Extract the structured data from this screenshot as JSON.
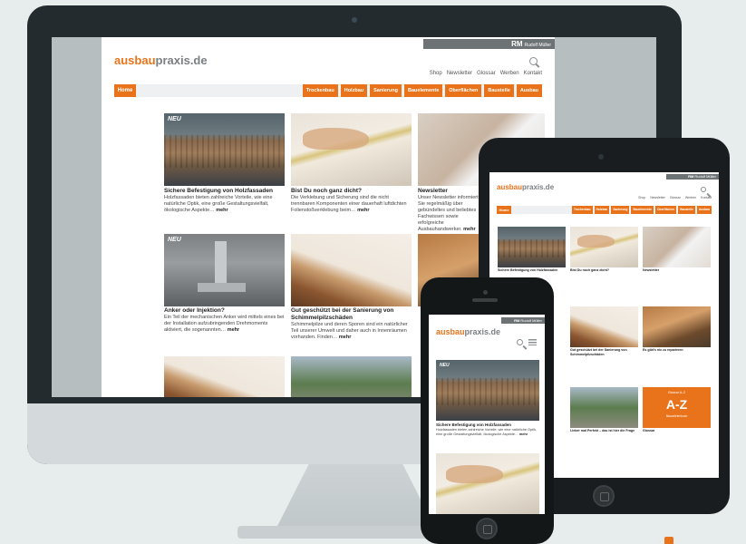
{
  "site": {
    "logo_part1": "ausbau",
    "logo_part2": "praxis.de",
    "brand_badge": "RM",
    "brand_name": "Rudolf Müller",
    "top_links": [
      "Shop",
      "Newsletter",
      "Glossar",
      "Werben",
      "Kontakt"
    ],
    "nav_home": "Home",
    "nav_items": [
      "Trockenbau",
      "Holzbau",
      "Sanierung",
      "Bauelemente",
      "Oberflächen",
      "Baustelle",
      "Ausbau"
    ]
  },
  "tiles": [
    {
      "badge": "NEU",
      "title": "Sichere Befestigung von Holzfassaden",
      "text": "Holzfassaden bieten zahlreiche Vorteile, wie eine natürliche Optik, eine große Gestaltungsvielfalt, ökologische Aspekte…",
      "more": "mehr"
    },
    {
      "title": "Bist Du noch ganz dicht?",
      "text": "Die Verklebung und Sicherung sind die nicht trennbaren Komponenten einer dauerhaft luftdichten Folienstoßverklebung beim…",
      "more": "mehr"
    },
    {
      "title": "Newsletter",
      "text": "Unser Newsletter informiert Sie regelmäßig über gebündeltes und beliebtes Fachwissen sowie erfolgreiche Ausbauhandwerker.",
      "more": "mehr"
    },
    {
      "badge": "NEU",
      "title": "Anker oder Injektion?",
      "text": "Ein Teil der mechanischen Anker wird mittels eines bei der Installation aufzubringenden Drehmoments aktiviert, die sogenannten…",
      "more": "mehr"
    },
    {
      "title": "Gut geschützt bei der Sanierung von Schimmelpilzschäden",
      "text": "Schimmelpilze und deren Sporen sind ein natürlicher Teil unserer Umwelt und daher auch in Innenräumen vorhanden. Finden…",
      "more": "mehr"
    }
  ],
  "tablet_tiles": [
    {
      "title": "Sichere Befestigung von Holzfassaden"
    },
    {
      "title": "Bist Du noch ganz dicht?"
    },
    {
      "title": "Newsletter"
    },
    {
      "title": "Gut geschützt bei der Sanierung von Schimmelpilzschäden"
    },
    {
      "title": "Es gibt’s nix zu reparieren"
    },
    {
      "title": "Lieber mal Perfekt – das ist hier die Frage"
    },
    {
      "title": "Glossar"
    }
  ],
  "az_tile": {
    "label_top": "Glossar A–Z",
    "big": "A-Z",
    "label_bottom": "Bauwörterbuch"
  },
  "colors": {
    "accent": "#e8731a",
    "logo_gray": "#7a7f82",
    "brand_strip": "#6d7275"
  }
}
